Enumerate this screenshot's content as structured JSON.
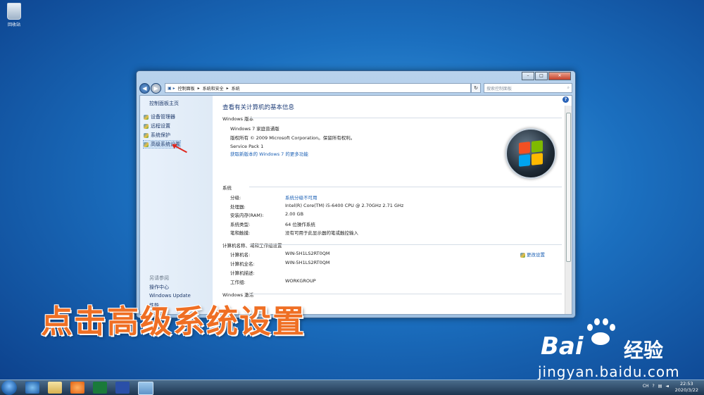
{
  "desktop": {
    "recycle_bin_label": "回收站"
  },
  "window": {
    "address_path": [
      "控制面板",
      "系统和安全",
      "系统"
    ],
    "search_placeholder": "搜索控制面板",
    "left_pane": {
      "home": "控制面板主页",
      "links": [
        "设备管理器",
        "远程设置",
        "系统保护",
        "高级系统设置"
      ],
      "see_also_heading": "另请参阅",
      "see_also": [
        "操作中心",
        "Windows Update",
        "性能..."
      ]
    },
    "main": {
      "title": "查看有关计算机的基本信息",
      "edition_heading": "Windows 版本",
      "edition": "Windows 7 家庭普通版",
      "copyright": "版权所有 © 2009 Microsoft Corporation。保留所有权利。",
      "service_pack": "Service Pack 1",
      "more_features_link": "获取新版本的 Windows 7 的更多功能",
      "system_heading": "系统",
      "system_rows": [
        {
          "label": "分级:",
          "value": "系统分级不可用"
        },
        {
          "label": "处理器:",
          "value": "Intel(R) Core(TM) i5-6400 CPU @ 2.70GHz   2.71 GHz"
        },
        {
          "label": "安装内存(RAM):",
          "value": "2.00 GB"
        },
        {
          "label": "系统类型:",
          "value": "64 位操作系统"
        },
        {
          "label": "笔和触摸:",
          "value": "没有可用于此显示器的笔或触控输入"
        }
      ],
      "computer_heading": "计算机名称、域和工作组设置",
      "computer_rows": [
        {
          "label": "计算机名:",
          "value": "WIN-5H1LS2RT0QM"
        },
        {
          "label": "计算机全名:",
          "value": "WIN-5H1LS2RT0QM"
        },
        {
          "label": "计算机描述:",
          "value": ""
        },
        {
          "label": "工作组:",
          "value": "WORKGROUP"
        }
      ],
      "change_settings": "更改设置",
      "activation_heading": "Windows 激活"
    }
  },
  "overlay_caption": "点击高级系统设置",
  "watermark": {
    "brand": "Bai",
    "brand2": "经验",
    "url": "jingyan.baidu.com"
  },
  "taskbar": {
    "tray_text": [
      "CH",
      "?"
    ],
    "time": "22:53",
    "date": "2020/3/22"
  },
  "colors": {
    "accent": "#1a5fb4",
    "overlay": "#ef6f24",
    "arrow": "#e0271e"
  }
}
